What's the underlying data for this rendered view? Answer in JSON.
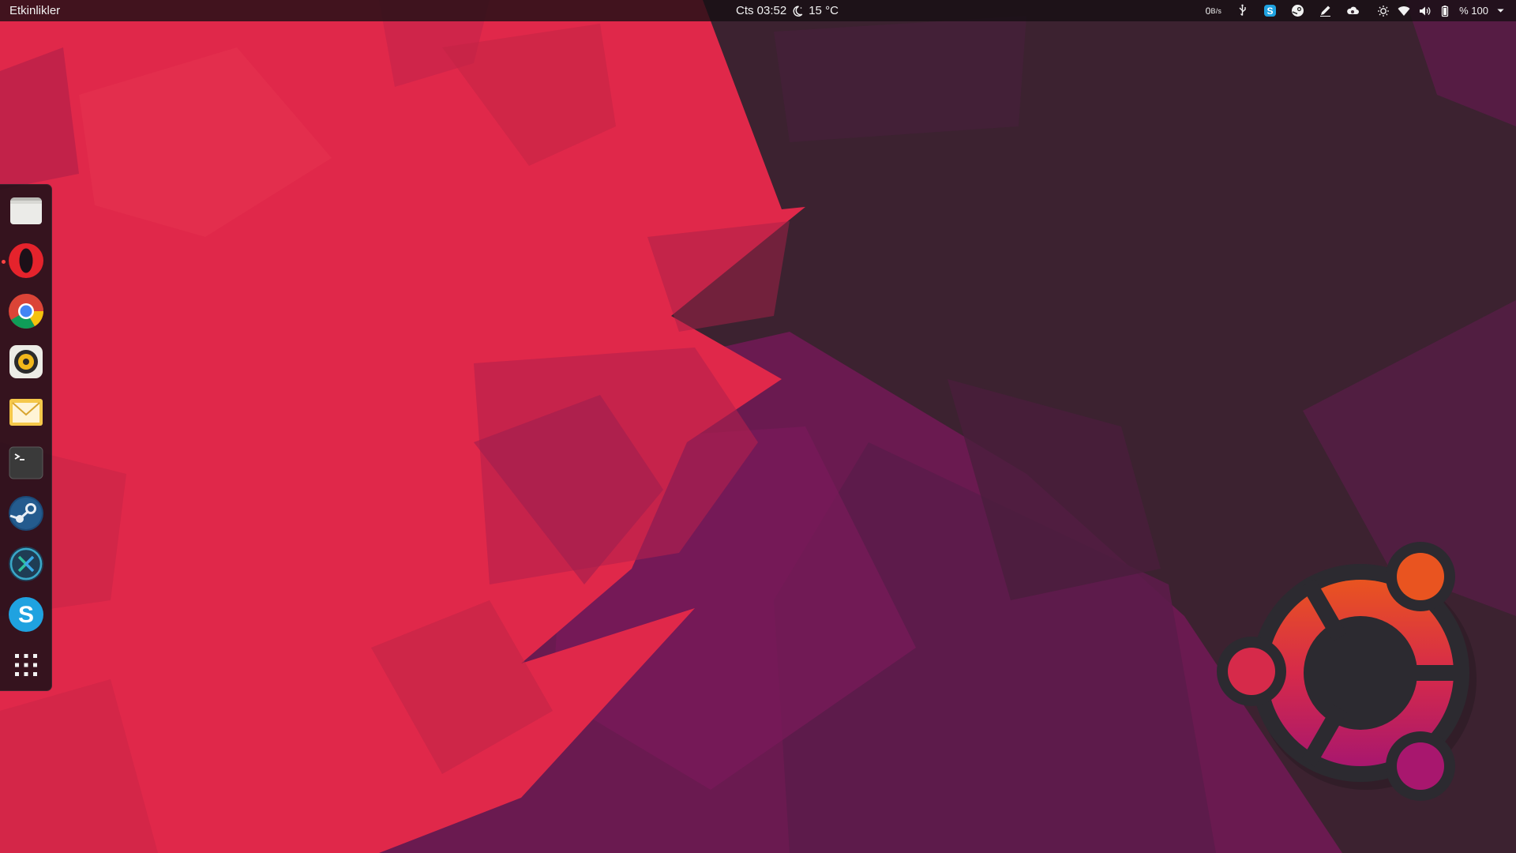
{
  "topbar": {
    "activities_label": "Etkinlikler",
    "clock": "Cts 03:52",
    "weather_icon": "weather-clear-night-icon",
    "temperature": "15 °C",
    "tray": {
      "netspeed_value": "0",
      "netspeed_unit": "B/s",
      "items": [
        "usb-icon",
        "skype-icon",
        "steam-icon",
        "pen-icon",
        "weather-cloud-icon"
      ],
      "status": [
        "brightness-icon",
        "wifi-icon",
        "volume-icon",
        "battery-icon"
      ],
      "battery_text": "% 100",
      "menu_icon": "chevron-down-icon"
    }
  },
  "dock": {
    "apps": [
      {
        "name": "Dosyalar",
        "icon": "files-icon"
      },
      {
        "name": "Opera",
        "icon": "opera-icon",
        "running": true
      },
      {
        "name": "Google Chrome",
        "icon": "chrome-icon"
      },
      {
        "name": "Rhythmbox",
        "icon": "rhythmbox-icon"
      },
      {
        "name": "Mail",
        "icon": "mail-icon"
      },
      {
        "name": "Terminal",
        "icon": "terminal-icon"
      },
      {
        "name": "Steam",
        "icon": "steam-icon"
      },
      {
        "name": "Remote Desktop",
        "icon": "remote-desktop-icon"
      },
      {
        "name": "Skype",
        "icon": "skype-icon"
      },
      {
        "name": "Uygulamaları Göster",
        "icon": "app-grid-icon"
      }
    ]
  },
  "colors": {
    "wallpaper_red": "#e0284a",
    "wallpaper_dark": "#3c2230",
    "wallpaper_purple": "#6e1a52",
    "ubuntu_orange": "#e95420",
    "ubuntu_magenta": "#a8176e",
    "logo_dark": "#2c2a30"
  }
}
